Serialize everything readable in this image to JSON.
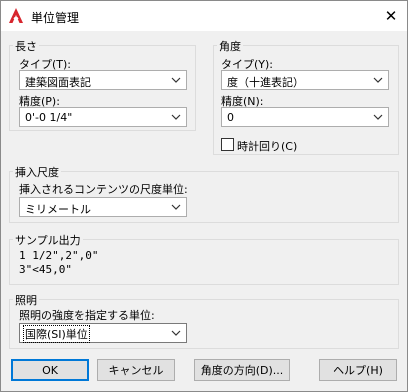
{
  "window": {
    "title": "単位管理",
    "close_glyph": "✕"
  },
  "length": {
    "group_label": "長さ",
    "type_label": "タイプ(T):",
    "type_value": "建築図面表記",
    "precision_label": "精度(P):",
    "precision_value": "0'-0 1/4\""
  },
  "angle": {
    "group_label": "角度",
    "type_label": "タイプ(Y):",
    "type_value": "度（十進表記）",
    "precision_label": "精度(N):",
    "precision_value": "0",
    "clockwise_label": "時計回り(C)",
    "clockwise_checked": false
  },
  "insertion": {
    "group_label": "挿入尺度",
    "units_label": "挿入されるコンテンツの尺度単位:",
    "units_value": "ミリメートル"
  },
  "sample": {
    "group_label": "サンプル出力",
    "line1": "1 1/2\",2\",0\"",
    "line2": "3\"<45,0\""
  },
  "lighting": {
    "group_label": "照明",
    "units_label": "照明の強度を指定する単位:",
    "units_value": "国際(SI)単位"
  },
  "buttons": {
    "ok": "OK",
    "cancel": "キャンセル",
    "direction": "角度の方向(D)...",
    "help": "ヘルプ(H)"
  },
  "colors": {
    "logo_red": "#d7262e",
    "default_button_border": "#0078d7"
  }
}
